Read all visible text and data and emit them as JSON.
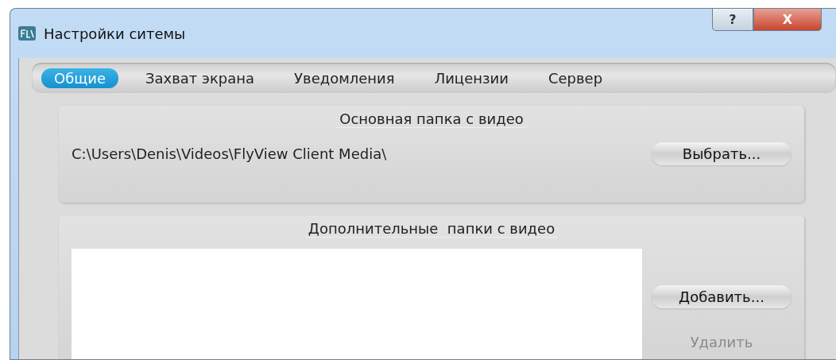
{
  "window": {
    "title": "Настройки ситемы",
    "help_button": "?",
    "close_button": "X"
  },
  "tabs": [
    {
      "label": "Общие",
      "selected": true
    },
    {
      "label": "Захват экрана",
      "selected": false
    },
    {
      "label": "Уведомления",
      "selected": false
    },
    {
      "label": "Лицензии",
      "selected": false
    },
    {
      "label": "Сервер",
      "selected": false
    }
  ],
  "main_folder": {
    "title": "Основная папка с видео",
    "path": "C:\\Users\\Denis\\Videos\\FlyView Client Media\\",
    "buttons": [
      {
        "label": "Выбрать...",
        "disabled": false
      }
    ]
  },
  "extra_folders": {
    "title": "Дополнительные  папки с видео",
    "buttons": [
      {
        "label": "Добавить...",
        "disabled": false
      },
      {
        "label": "Удалить",
        "disabled": true
      }
    ]
  }
}
